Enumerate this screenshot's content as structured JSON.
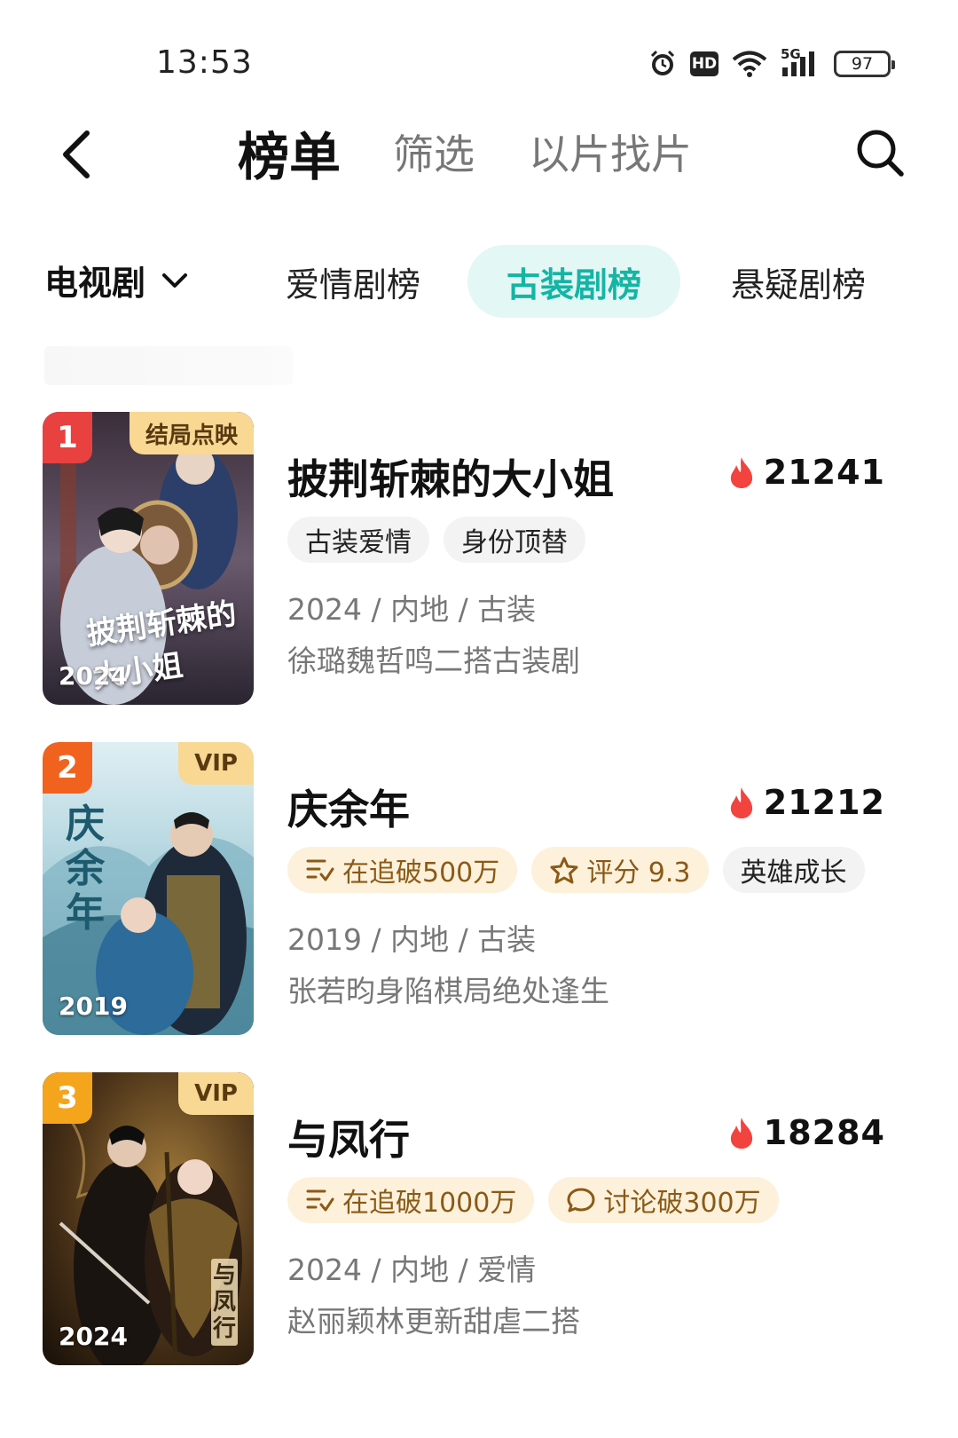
{
  "status_bar": {
    "time": "13:53",
    "battery": "97",
    "hd": "HD",
    "network": "5G",
    "icons": [
      "alarm-icon",
      "hd-icon",
      "wifi-icon",
      "signal-5g-icon",
      "battery-icon"
    ]
  },
  "header": {
    "tabs": [
      {
        "label": "榜单",
        "active": true
      },
      {
        "label": "筛选",
        "active": false
      },
      {
        "label": "以片找片",
        "active": false
      }
    ]
  },
  "category": {
    "selector_label": "电视剧",
    "chips": [
      {
        "label": "爱情剧榜",
        "active": false
      },
      {
        "label": "古装剧榜",
        "active": true
      },
      {
        "label": "悬疑剧榜",
        "active": false
      }
    ]
  },
  "colors": {
    "accent": "#14b5a4",
    "accent_bg": "#e3f7f5",
    "rank_1": "#e8413f",
    "rank_2": "#f2621f",
    "rank_3": "#f4a51c",
    "vip_tag": "#f8d893",
    "heat": "#f2433e"
  },
  "items": [
    {
      "rank": "1",
      "corner_tag": "结局点映",
      "year": "2024",
      "title": "披荆斩棘的大小姐",
      "heat": "21241",
      "tags": [
        {
          "label": "古装爱情",
          "icon": "",
          "style": "gray"
        },
        {
          "label": "身份顶替",
          "icon": "",
          "style": "gray"
        }
      ],
      "meta": "2024 / 内地 / 古装",
      "desc": "徐璐魏哲鸣二搭古装剧",
      "poster_text": "披荆斩棘的大小姐"
    },
    {
      "rank": "2",
      "corner_tag": "VIP",
      "year": "2019",
      "title": "庆余年",
      "heat": "21212",
      "tags": [
        {
          "label": "在追破500万",
          "icon": "list-check-icon",
          "style": "gold"
        },
        {
          "label": "评分 9.3",
          "icon": "star-icon",
          "style": "gold"
        },
        {
          "label": "英雄成长",
          "icon": "",
          "style": "gray"
        }
      ],
      "meta": "2019 / 内地 / 古装",
      "desc": "张若昀身陷棋局绝处逢生",
      "poster_text": "庆余年"
    },
    {
      "rank": "3",
      "corner_tag": "VIP",
      "year": "2024",
      "title": "与凤行",
      "heat": "18284",
      "tags": [
        {
          "label": "在追破1000万",
          "icon": "list-check-icon",
          "style": "gold"
        },
        {
          "label": "讨论破300万",
          "icon": "comment-icon",
          "style": "gold"
        }
      ],
      "meta": "2024 / 内地 / 爱情",
      "desc": "赵丽颖林更新甜虐二搭",
      "poster_text": "与凤行"
    }
  ]
}
